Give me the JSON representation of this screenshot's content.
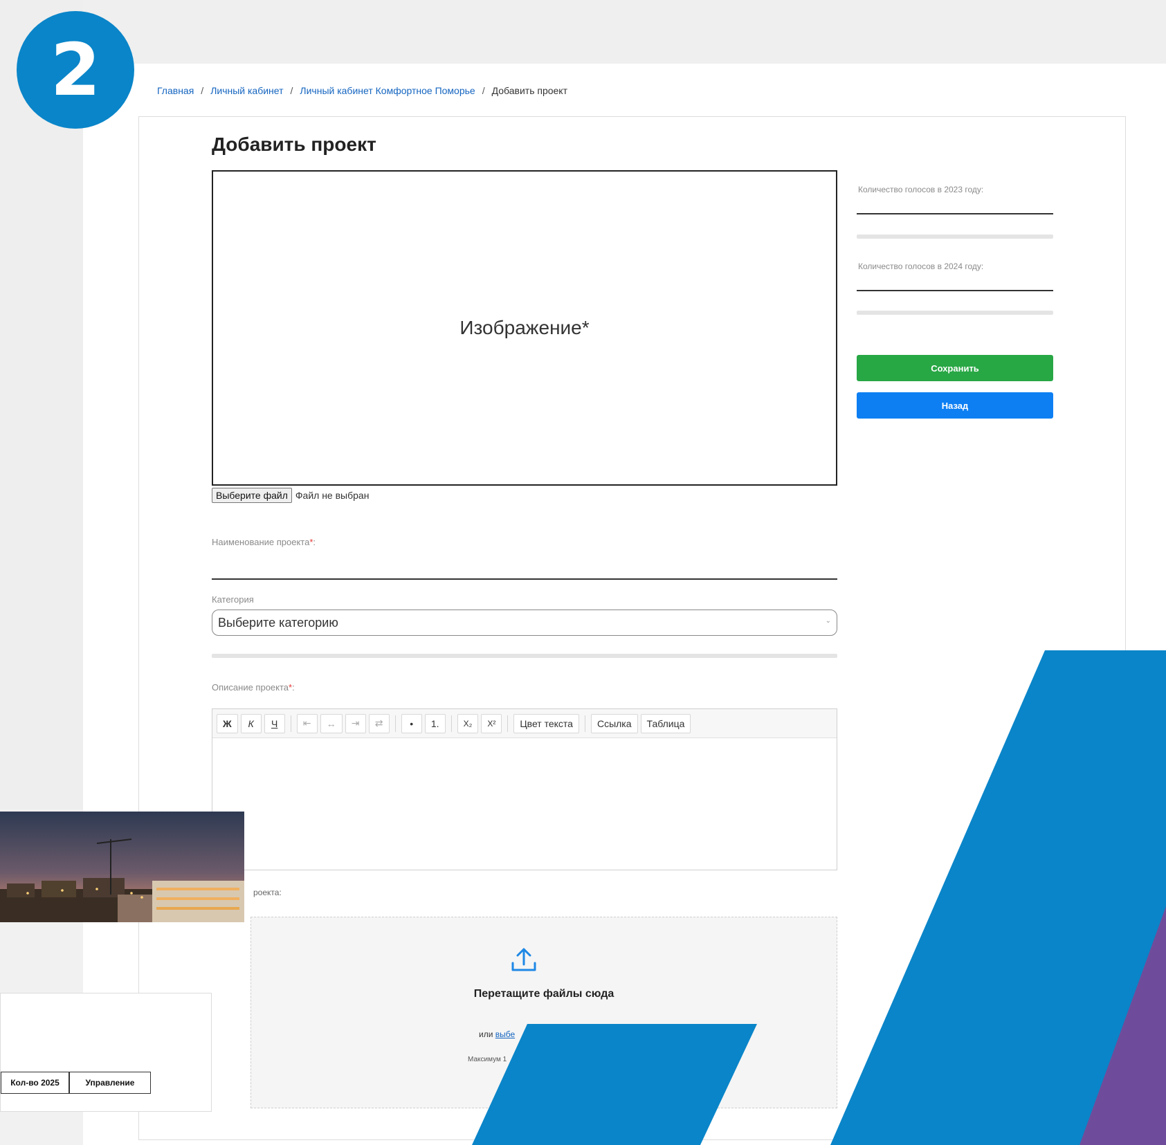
{
  "step_badge": "2",
  "breadcrumb": {
    "items": [
      "Главная",
      "Личный кабинет",
      "Личный кабинет Комфортное Поморье"
    ],
    "current": "Добавить проект",
    "separator": "/"
  },
  "page_title": "Добавить проект",
  "image_box": {
    "label": "Изображение*",
    "file_button": "Выберите файл",
    "file_status": "Файл не выбран"
  },
  "form": {
    "name_label": "Наименование проекта",
    "category_label": "Категория",
    "category_value": "Выберите категорию",
    "description_label": "Описание проекта",
    "required_mark": "*",
    "label_suffix": ":"
  },
  "toolbar": {
    "bold": "Ж",
    "italic": "К",
    "underline": "Ч",
    "align_left": "⇤",
    "align_center": "↔",
    "align_right": "⇥",
    "align_justify": "⇄",
    "bullets": "•",
    "numbered": "1.",
    "subscript": "X₂",
    "superscript": "X²",
    "text_color": "Цвет текста",
    "link": "Ссылка",
    "table": "Таблица"
  },
  "upload": {
    "section_label": "роекта:",
    "title": "Перетащите файлы сюда",
    "or_text": "или",
    "link_text": "выбе",
    "limit_text": "Максимум 1"
  },
  "sidebar": {
    "votes_2023_label": "Количество голосов в 2023 году:",
    "votes_2024_label": "Количество голосов в 2024 году:",
    "save_label": "Сохранить",
    "back_label": "Назад"
  },
  "overlay_table": {
    "headers": [
      "Кол-во 2025",
      "Управление"
    ]
  },
  "colors": {
    "badge": "#0a85c9",
    "save": "#28a745",
    "back": "#0d7ff3",
    "decor_blue": "#0a85c9",
    "decor_purple": "#6f4c9b",
    "link": "#1565c0"
  }
}
